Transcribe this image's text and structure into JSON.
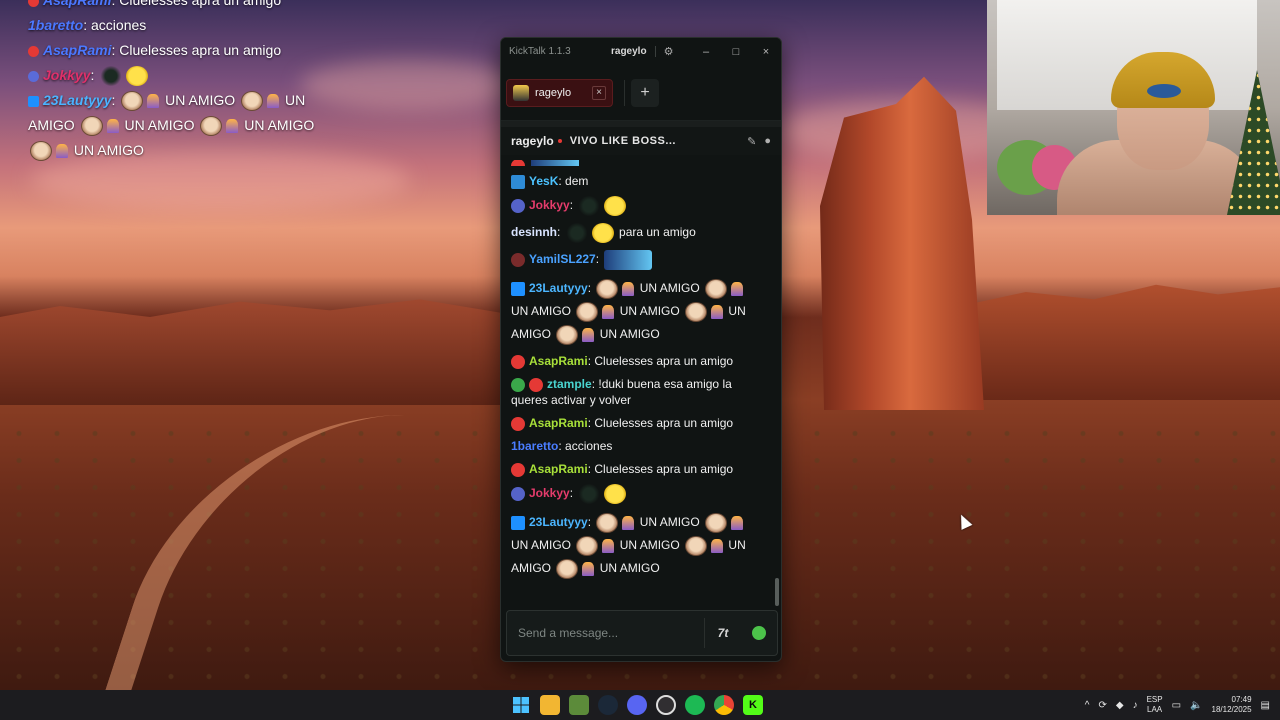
{
  "overlay_chat": {
    "lines": [
      {
        "user": "AsapRami",
        "sep": ": ",
        "text": "Cluelesses apra un amigo",
        "user_color": "#4b78ff",
        "badge_color": "#e53935"
      },
      {
        "user": "1baretto",
        "sep": ": ",
        "text": "acciones",
        "user_color": "#4b78ff",
        "badge_color": ""
      },
      {
        "user": "AsapRami",
        "sep": ": ",
        "text": "Cluelesses apra un amigo",
        "user_color": "#4b78ff",
        "badge_color": "#e53935"
      },
      {
        "user": "Jokkyy",
        "sep": ":",
        "text": "",
        "user_color": "#e0306a",
        "badge_color": "#5a6bd8"
      },
      {
        "user": "23Lautyyy",
        "sep": ":",
        "text": "UN AMIGO",
        "user_color": "#4bb3ff",
        "badge_color": "#1e90ff"
      }
    ],
    "wrap_lines": [
      "AMIGO",
      "UN AMIGO",
      "UN AMIGO",
      "UN AMIGO"
    ]
  },
  "window": {
    "app_title": "KickTalk 1.1.3",
    "user_pill": "rageylo",
    "tab_label": "rageylo",
    "tab_close": "×",
    "add_tab": "+",
    "minimize": "–",
    "maximize": "□",
    "close": "×"
  },
  "chat_header": {
    "streamer": "rageylo",
    "stream_title": "VIVO LIKE BOSS..."
  },
  "messages": [
    {
      "user": "YesK",
      "text": "dem",
      "user_color": "#4cc3ff",
      "badge_color": "#2e8bd6"
    },
    {
      "user": "Jokkyy",
      "text": "",
      "user_color": "#e53c6c",
      "badge_color": "#5563c8"
    },
    {
      "user": "desinnh",
      "text": "para un amigo",
      "user_color": "#d9e4ff",
      "badge_color": ""
    },
    {
      "user": "YamilSL227",
      "text": "",
      "user_color": "#4aa2ff",
      "badge_color": "#7a2b2b"
    },
    {
      "user": "23Lautyyy",
      "text": "UN AMIGO",
      "user_color": "#4cb6ff",
      "badge_color": "#1e90ff"
    },
    {
      "user": "AsapRami",
      "text": "Cluelesses apra un amigo",
      "user_color": "#a8e03a",
      "badge_color": "#e53935"
    },
    {
      "user": "ztample",
      "text": "!duki buena esa amigo la queres activar y volver",
      "user_color": "#49d4d0",
      "badge_color": "#e53935"
    },
    {
      "user": "AsapRami",
      "text": "Cluelesses apra un amigo",
      "user_color": "#a8e03a",
      "badge_color": "#e53935"
    },
    {
      "user": "1baretto",
      "text": "acciones",
      "user_color": "#4a7dff",
      "badge_color": ""
    },
    {
      "user": "AsapRami",
      "text": "Cluelesses apra un amigo",
      "user_color": "#a8e03a",
      "badge_color": "#e53935"
    },
    {
      "user": "Jokkyy",
      "text": "",
      "user_color": "#e53c6c",
      "badge_color": "#5563c8"
    },
    {
      "user": "23Lautyyy",
      "text": "UN AMIGO",
      "user_color": "#4cb6ff",
      "badge_color": "#1e90ff"
    }
  ],
  "amigo_wrap": [
    "UN AMIGO",
    "UN AMIGO",
    "UN",
    "AMIGO",
    "UN AMIGO"
  ],
  "input": {
    "placeholder": "Send a message...",
    "seventv_icon": "7tv-icon",
    "emote_icon": "emote-picker-icon"
  },
  "taskbar": {
    "lang_top": "ESP",
    "lang_bottom": "LAA",
    "time": "07:49",
    "date": "18/12/2025",
    "icons": [
      "windows-start-icon",
      "file-explorer-icon",
      "minecraft-icon",
      "steam-icon",
      "discord-icon",
      "obs-icon",
      "spotify-icon",
      "chrome-icon",
      "kick-icon"
    ]
  },
  "colors": {
    "kick_green": "#53fc18",
    "window_bg": "#101413",
    "tab_bg": "#3a1012"
  }
}
